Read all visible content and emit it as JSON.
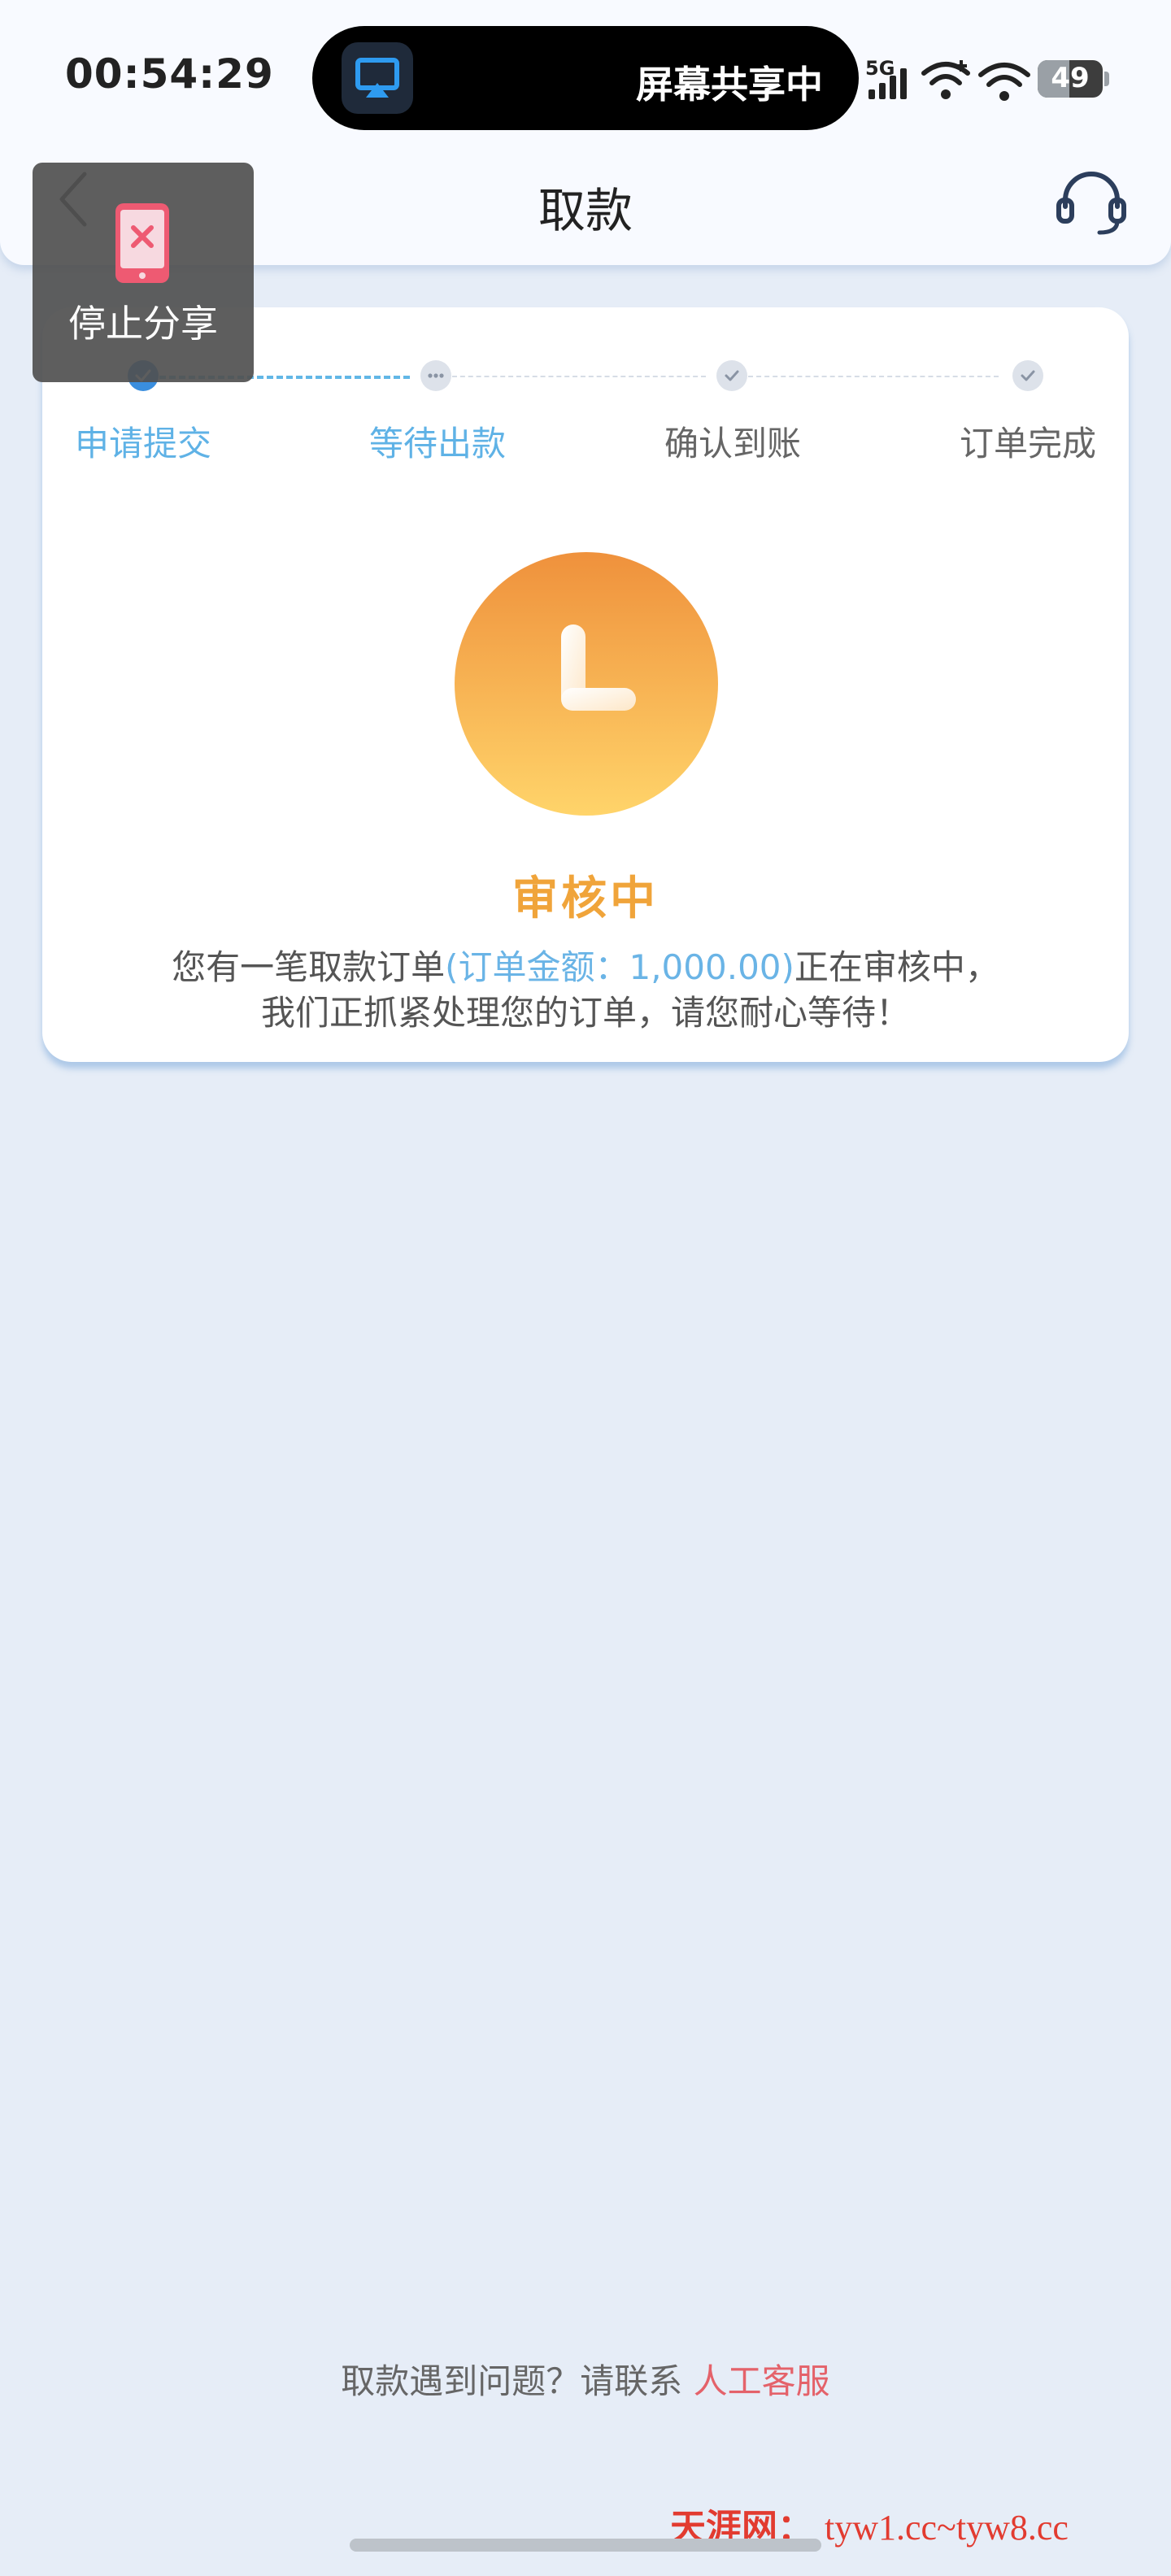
{
  "status_bar": {
    "time": "00:54:29",
    "island_label": "屏幕共享中",
    "network": "5G",
    "battery_level": "49",
    "battery_fraction": 0.49
  },
  "nav": {
    "title": "取款",
    "back_icon": "chevron-left-icon",
    "support_icon": "headset-icon"
  },
  "overlay": {
    "stop_share_label": "停止分享",
    "icon": "phone-x-icon"
  },
  "steps": [
    {
      "label": "申请提交",
      "state": "done"
    },
    {
      "label": "等待出款",
      "state": "current"
    },
    {
      "label": "确认到账",
      "state": "pending"
    },
    {
      "label": "订单完成",
      "state": "pending"
    }
  ],
  "status": {
    "icon": "clock-icon",
    "title": "审核中",
    "desc_prefix": "您有一笔取款订单",
    "desc_amount": "(订单金额：1,000.00)",
    "desc_suffix": "正在审核中，",
    "desc_line2": "我们正抓紧处理您的订单，请您耐心等待！"
  },
  "footer": {
    "text": "取款遇到问题？请联系",
    "link": "人工客服"
  },
  "watermark": {
    "brand": "天涯网：",
    "urls": "tyw1.cc~tyw8.cc"
  },
  "colors": {
    "accent_blue": "#62b7e6",
    "accent_orange": "#f0a43a",
    "link_red": "#e4626a",
    "background": "#e6edf7"
  }
}
